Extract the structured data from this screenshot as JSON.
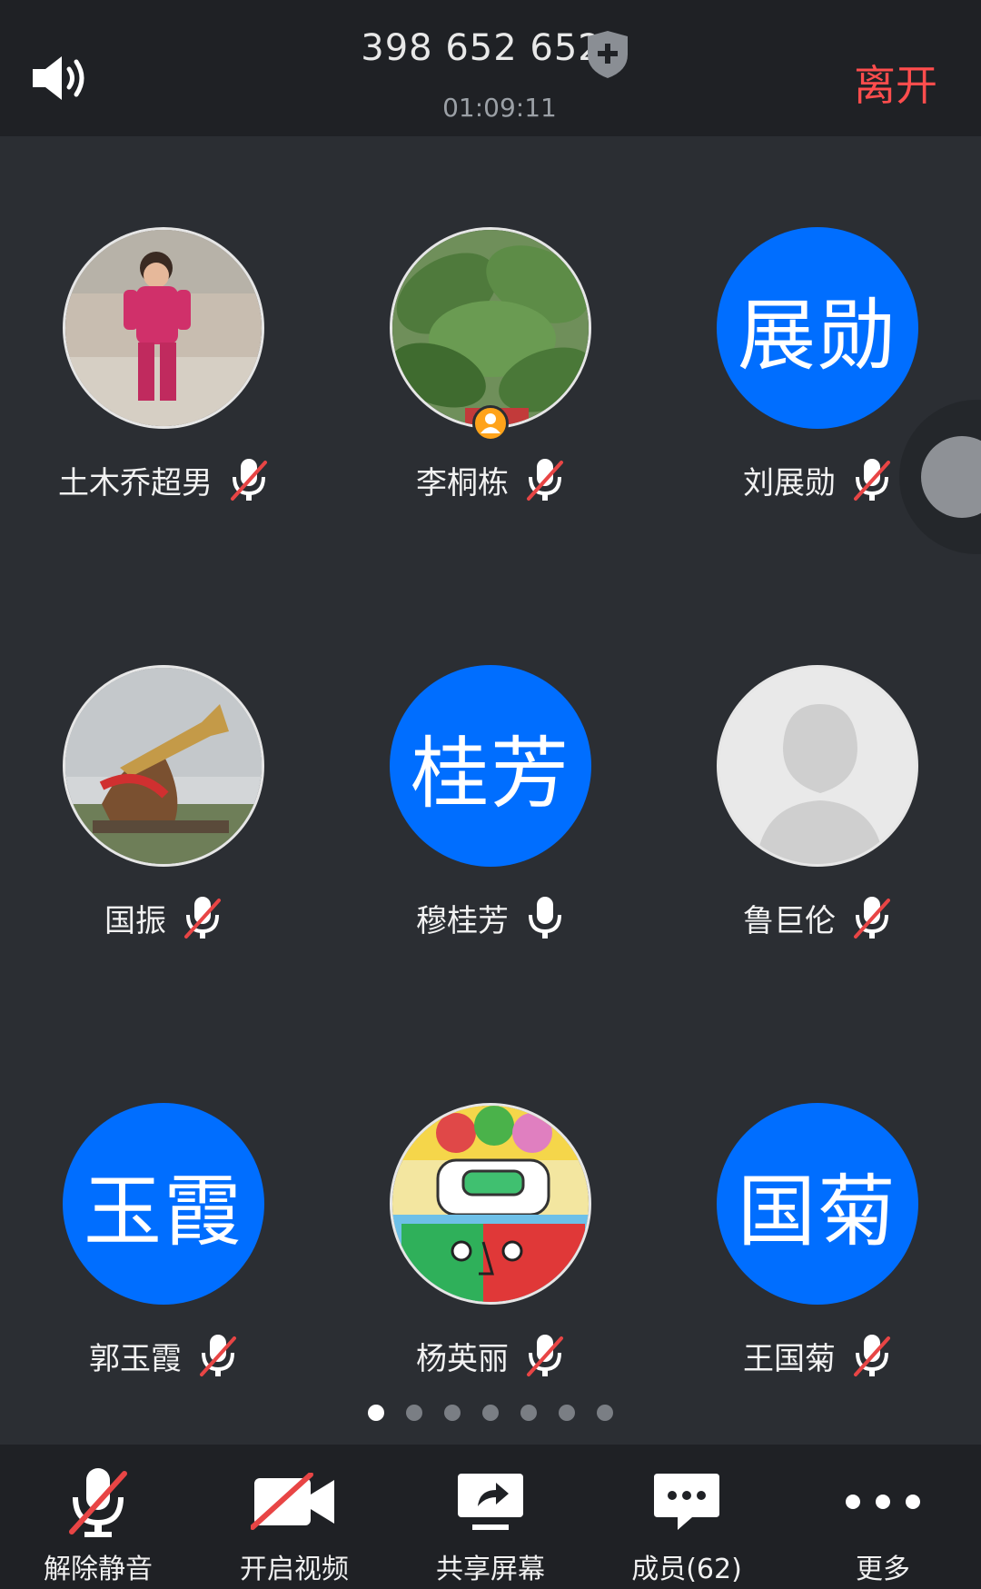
{
  "header": {
    "meeting_id": "398 652 652",
    "duration": "01:09:11",
    "leave_label": "离开"
  },
  "participants": [
    {
      "name": "土木乔超男",
      "avatar_text": "",
      "muted": true
    },
    {
      "name": "李桐栋",
      "avatar_text": "",
      "muted": true,
      "host": true
    },
    {
      "name": "刘展勋",
      "avatar_text": "展勋",
      "muted": true
    },
    {
      "name": "国振",
      "avatar_text": "",
      "muted": true
    },
    {
      "name": "穆桂芳",
      "avatar_text": "桂芳",
      "muted": false
    },
    {
      "name": "鲁巨伦",
      "avatar_text": "",
      "muted": true
    },
    {
      "name": "郭玉霞",
      "avatar_text": "玉霞",
      "muted": true
    },
    {
      "name": "杨英丽",
      "avatar_text": "",
      "muted": true
    },
    {
      "name": "王国菊",
      "avatar_text": "国菊",
      "muted": true
    }
  ],
  "pagination": {
    "total_pages": 7,
    "current_page": 1
  },
  "toolbar": {
    "unmute_label": "解除静音",
    "video_label": "开启视频",
    "share_label": "共享屏幕",
    "members_label": "成员(62)",
    "more_label": "更多"
  },
  "colors": {
    "accent": "#006eff",
    "leave": "#ff4d4d",
    "mute_slash": "#e84545",
    "host_badge": "#ffa31a"
  }
}
